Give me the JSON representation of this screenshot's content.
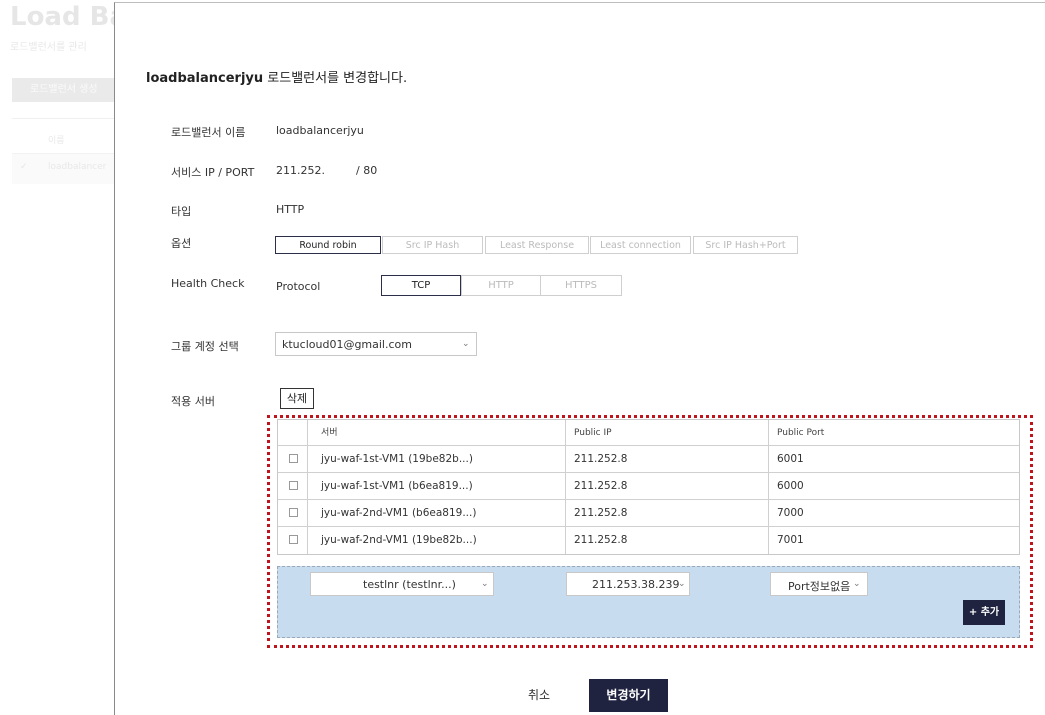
{
  "background": {
    "title": "Load Bal",
    "subtitle": "로드밸런서를 관리",
    "create_button": "로드밸런서 생성",
    "table_header_name": "이름",
    "row_check": "✓",
    "row_name": "loadbalancer"
  },
  "modal": {
    "header_name": "loadbalancerjyu",
    "header_text": " 로드밸런서를 변경합니다.",
    "fields": {
      "lb_name_label": "로드밸런서 이름",
      "lb_name_value": "loadbalancerjyu",
      "service_label": "서비스 IP / PORT",
      "service_ip": "211.252.",
      "service_port": "/ 80",
      "type_label": "타입",
      "type_value": "HTTP",
      "option_label": "옵션",
      "health_label": "Health Check",
      "protocol_label": "Protocol",
      "group_label": "그룹 계정 선택",
      "group_value": "ktucloud01@gmail.com",
      "server_label": "적용 서버"
    },
    "options": [
      "Round robin",
      "Src IP Hash",
      "Least Response",
      "Least connection",
      "Src IP Hash+Port"
    ],
    "selected_option": "Round robin",
    "protocols": [
      "TCP",
      "HTTP",
      "HTTPS"
    ],
    "selected_protocol": "TCP",
    "delete_button": "삭제",
    "table": {
      "headers": [
        "서버",
        "Public IP",
        "Public Port"
      ],
      "rows": [
        {
          "server": "jyu-waf-1st-VM1 (19be82b...)",
          "ip": "211.252.8",
          "port": "6001"
        },
        {
          "server": "jyu-waf-1st-VM1 (b6ea819...)",
          "ip": "211.252.8",
          "port": "6000"
        },
        {
          "server": "jyu-waf-2nd-VM1 (b6ea819...)",
          "ip": "211.252.8",
          "port": "7000"
        },
        {
          "server": "jyu-waf-2nd-VM1 (19be82b...)",
          "ip": "211.252.8",
          "port": "7001"
        }
      ]
    },
    "add_row": {
      "server_select": "testlnr (testlnr...)",
      "ip_select": "211.253.38.239",
      "port_select": "Port정보없음",
      "add_button": "+ 추가"
    },
    "cancel_button": "취소",
    "confirm_button": "변경하기"
  },
  "colors": {
    "primary": "#1f2340",
    "highlight": "#c0141c",
    "add_row_bg": "#c8dcf0"
  },
  "icons": {
    "dropdown": "chevron-down-icon",
    "checkbox": "checkbox-icon"
  }
}
